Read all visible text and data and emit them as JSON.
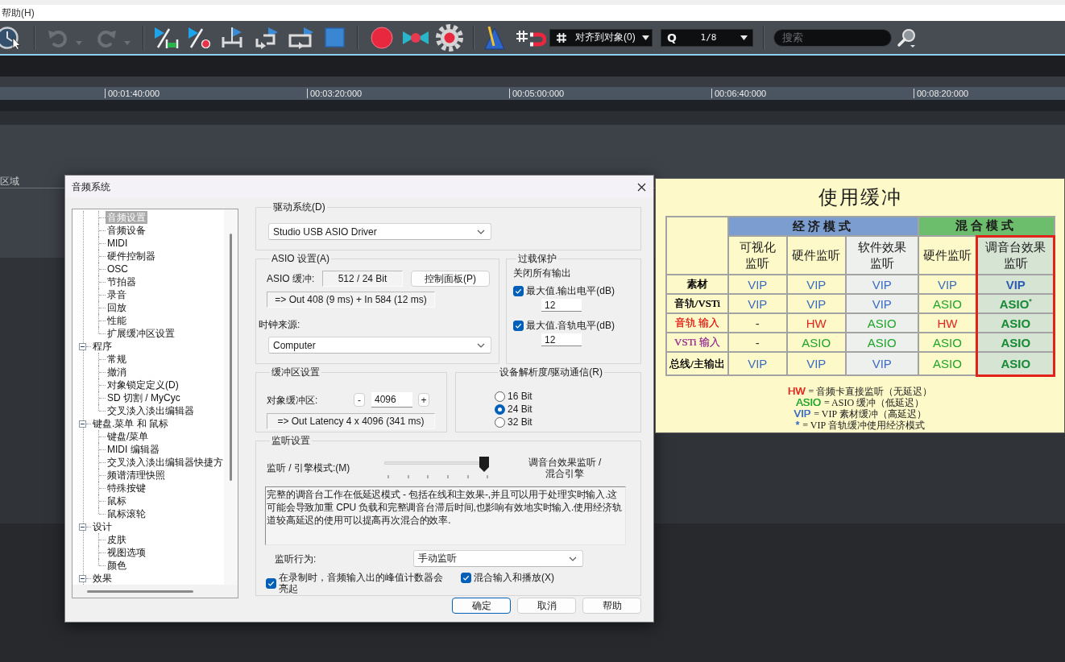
{
  "menu_bar": {
    "items": [
      "帮助(H)"
    ]
  },
  "toolbar": {
    "undo": {
      "disabled": true
    },
    "redo": {
      "disabled": true
    },
    "snap": {
      "value": "对齐到对象(0)"
    },
    "quantize": {
      "label": "Q",
      "value": "1/8"
    },
    "search": {
      "placeholder": "搜索"
    }
  },
  "ruler": {
    "marks": [
      "00:01:40:000",
      "00:03:20:000",
      "00:05:00:000",
      "00:06:40:000",
      "00:08:20:000"
    ]
  },
  "track_area": {
    "label": "区域"
  },
  "dialog": {
    "title": "音频系统",
    "tree": {
      "items": [
        {
          "children": [
            {
              "label": "音频设置",
              "selected": true
            },
            {
              "label": "音频设备",
              "selected": false
            },
            {
              "label": "MIDI",
              "selected": false
            },
            {
              "label": "硬件控制器",
              "selected": false
            },
            {
              "label": "OSC",
              "selected": false
            },
            {
              "label": "节拍器",
              "selected": false
            },
            {
              "label": "录音",
              "selected": false
            },
            {
              "label": "回放",
              "selected": false
            },
            {
              "label": "性能",
              "selected": false
            },
            {
              "label": "扩展缓冲区设置",
              "selected": false
            }
          ]
        },
        {
          "label": "程序",
          "selected": false,
          "expanded": true,
          "children": [
            {
              "label": "常规",
              "selected": false
            },
            {
              "label": "撤消",
              "selected": false
            },
            {
              "label": "对象锁定定义(D)",
              "selected": false
            },
            {
              "label": "SD 切割 / MyCyc",
              "selected": false
            },
            {
              "label": "交叉淡入淡出编辑器",
              "selected": false
            }
          ]
        },
        {
          "label": "键盘.菜单 和 鼠标",
          "selected": false,
          "expanded": true,
          "children": [
            {
              "label": "键盘/菜单",
              "selected": false
            },
            {
              "label": "MIDI 编辑器",
              "selected": false
            },
            {
              "label": "交叉淡入淡出编辑器快捷方",
              "selected": false
            },
            {
              "label": "频谱清理快照",
              "selected": false
            },
            {
              "label": "特殊按键",
              "selected": false
            },
            {
              "label": "鼠标",
              "selected": false
            },
            {
              "label": "鼠标滚轮",
              "selected": false
            }
          ]
        },
        {
          "label": "设计",
          "selected": false,
          "expanded": true,
          "children": [
            {
              "label": "皮肤",
              "selected": false
            },
            {
              "label": "视图选项",
              "selected": false
            },
            {
              "label": "颜色",
              "selected": false
            }
          ]
        },
        {
          "label": "效果",
          "selected": false,
          "expanded": true
        }
      ]
    },
    "driver_group": {
      "title": "驱动系统(D)",
      "driver": "Studio USB ASIO Driver"
    },
    "asio_group": {
      "title": "ASIO 设置(A)",
      "buffer_label": "ASIO 缓冲:",
      "buffer_value": "512 / 24 Bit",
      "control_panel_button": "控制面板(P)",
      "latency": "=> Out 408 (9 ms) + In 584 (12 ms)",
      "clock_label": "时钟来源:",
      "clock_source": "Computer"
    },
    "overload_group": {
      "title": "过载保护",
      "caption": "关闭所有输出",
      "options": [
        {
          "label": "最大值.输出电平(dB)",
          "checked": true,
          "value": "12"
        },
        {
          "label": "最大值.音轨电平(dB)",
          "checked": true,
          "value": "12"
        }
      ]
    },
    "buffer_group": {
      "title": "缓冲区设置",
      "label": "对象缓冲区:",
      "decrement": "-",
      "value": "4096",
      "increment": "+",
      "latency": "=> Out Latency 4 x 4096 (341 ms)"
    },
    "resolution_group": {
      "title": "设备解析度/驱动通信(R)",
      "options": [
        {
          "label": "16 Bit",
          "selected": false
        },
        {
          "label": "24 Bit",
          "selected": true
        },
        {
          "label": "32 Bit",
          "selected": false
        }
      ]
    },
    "monitor_group": {
      "title": "监听设置",
      "mode_label": "监听 / 引擎模式:(M)",
      "mode_slider": {
        "level": 1
      },
      "mode_value": "调音台效果监听 /\n混合引擎",
      "description": "完整的调音台工作在低延迟模式 - 包括在线和主效果-,并且可以用于处理实时输入.这可能会导致加重 CPU 负载和完整调音台滞后时间,也影响有效地实时输入.使用经济轨道较高延迟的使用可以提高再次混合的效率.",
      "behavior_label": "监听行为:",
      "behavior": "手动监听",
      "options": [
        {
          "label": "在录制时，音频输入出的峰值计数器会亮起",
          "checked": true
        },
        {
          "label": "混合输入和播放(X)",
          "checked": true
        }
      ]
    },
    "buttons": [
      {
        "label": "确定",
        "default": true
      },
      {
        "label": "取消",
        "default": false
      },
      {
        "label": "帮助",
        "default": false
      }
    ]
  },
  "buffer_help": {
    "title": "使用缓冲",
    "groups": [
      {
        "label": "经济模式",
        "color": "#7b9dd0",
        "columns": [
          {
            "label": "可视化监听",
            "color": "#fdf9c9",
            "highlighted": false
          },
          {
            "label": "硬件监听",
            "color": "#fdf9c9",
            "highlighted": false
          },
          {
            "label": "软件效果监听",
            "color": "#eef0ee",
            "highlighted": false
          }
        ]
      },
      {
        "label": "混合模式",
        "color": "#6cbd6c",
        "columns": [
          {
            "label": "硬件监听",
            "color": "#fdf9c9",
            "highlighted": false
          },
          {
            "label": "调音台效果监听",
            "color": "#d5e4d3",
            "highlighted": true
          }
        ]
      }
    ],
    "rows": [
      {
        "label": "素材",
        "color": "#000000",
        "cells": [
          {
            "text": "VIP",
            "color": "#3b6cc4"
          },
          {
            "text": "VIP",
            "color": "#3b6cc4"
          },
          {
            "text": "VIP",
            "color": "#3b6cc4"
          },
          {
            "text": "VIP",
            "color": "#3b6cc4"
          },
          {
            "text": "VIP",
            "color": "#2f5cb4"
          }
        ]
      },
      {
        "label": "音轨/VSTi",
        "color": "#000000",
        "cells": [
          {
            "text": "VIP",
            "color": "#3b6cc4"
          },
          {
            "text": "VIP",
            "color": "#3b6cc4"
          },
          {
            "text": "VIP",
            "color": "#3b6cc4"
          },
          {
            "text": "ASIO",
            "color": "#1fa52a"
          },
          {
            "text": "ASIO$^{*}$",
            "color": "#168a34"
          }
        ]
      },
      {
        "label": "音轨 输入",
        "color": "#e4261e",
        "cells": [
          {
            "text": "-",
            "color": "#333333"
          },
          {
            "text": "HW",
            "color": "#e4261e"
          },
          {
            "text": "ASIO",
            "color": "#1fa52a"
          },
          {
            "text": "HW",
            "color": "#e4261e"
          },
          {
            "text": "ASIO",
            "color": "#168a34"
          }
        ]
      },
      {
        "label": "VSTi 输入",
        "color": "#a03c96",
        "cells": [
          {
            "text": "-",
            "color": "#333333"
          },
          {
            "text": "ASIO",
            "color": "#1fa52a"
          },
          {
            "text": "ASIO",
            "color": "#1fa52a"
          },
          {
            "text": "ASIO",
            "color": "#1fa52a"
          },
          {
            "text": "ASIO",
            "color": "#168a34"
          }
        ]
      },
      {
        "label": "总线/主输出",
        "color": "#000000",
        "cells": [
          {
            "text": "VIP",
            "color": "#3b6cc4"
          },
          {
            "text": "VIP",
            "color": "#3b6cc4"
          },
          {
            "text": "VIP",
            "color": "#3b6cc4"
          },
          {
            "text": "ASIO",
            "color": "#1fa52a"
          },
          {
            "text": "ASIO",
            "color": "#168a34"
          }
        ]
      }
    ],
    "legend": [
      {
        "key": "HW",
        "color": "#e4261e",
        "text": "= 音频卡直接监听（无延迟）"
      },
      {
        "key": "ASIO",
        "color": "#1fa52a",
        "text": "= ASIO 缓冲（低延迟）"
      },
      {
        "key": "VIP",
        "color": "#3b6cc4",
        "text": "= VIP 素材缓冲（高延迟）"
      },
      {
        "key": "*",
        "color": "#3b6cc4",
        "text": "= VIP 音轨缓冲使用经济模式"
      }
    ]
  }
}
